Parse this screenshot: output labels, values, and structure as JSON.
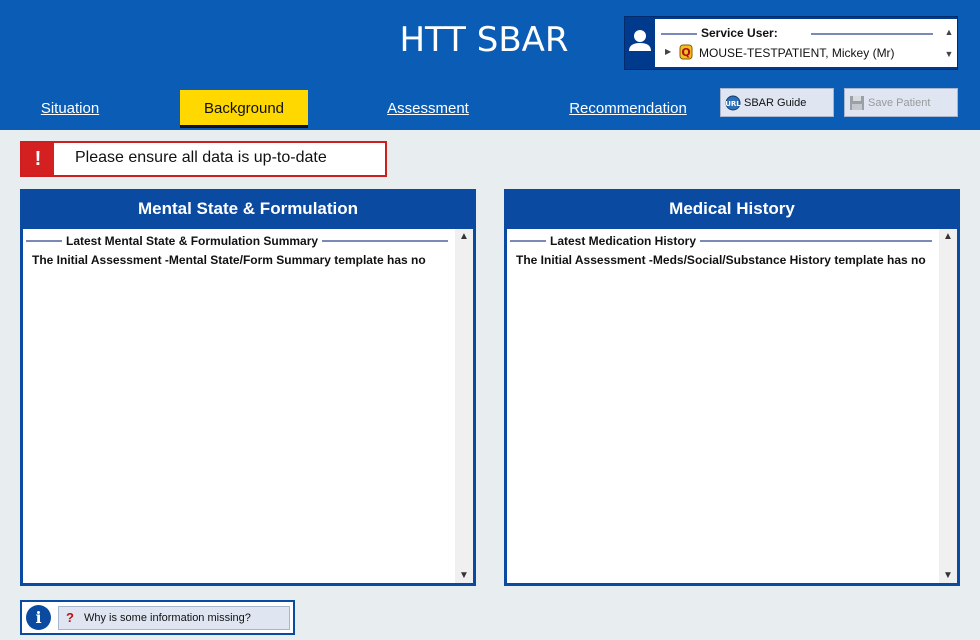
{
  "app": {
    "title": "HTT SBAR"
  },
  "service_user": {
    "label": "Service User:",
    "name": "MOUSE-TESTPATIENT, Mickey (Mr)"
  },
  "tabs": [
    {
      "label": "Situation",
      "active": false
    },
    {
      "label": "Background",
      "active": true
    },
    {
      "label": "Assessment",
      "active": false
    },
    {
      "label": "Recommendation",
      "active": false
    }
  ],
  "toolbar": {
    "guide_label": "SBAR Guide",
    "save_label": "Save Patient",
    "save_disabled": true
  },
  "warning": {
    "message": "Please ensure all data is up-to-date"
  },
  "panels": {
    "left": {
      "title": "Mental State & Formulation",
      "legend": "Latest Mental State & Formulation Summary",
      "text": "The Initial Assessment -Mental State/Form Summary template has no"
    },
    "right": {
      "title": "Medical History",
      "legend": "Latest Medication History",
      "text": "The Initial Assessment -Meds/Social/Substance History template has no"
    }
  },
  "info": {
    "button_label": "Why is some information missing?"
  },
  "colors": {
    "header_bg": "#0a5cb5",
    "panel_header": "#0a4aa0",
    "active_tab": "#ffd800",
    "warning_red": "#d42020"
  }
}
